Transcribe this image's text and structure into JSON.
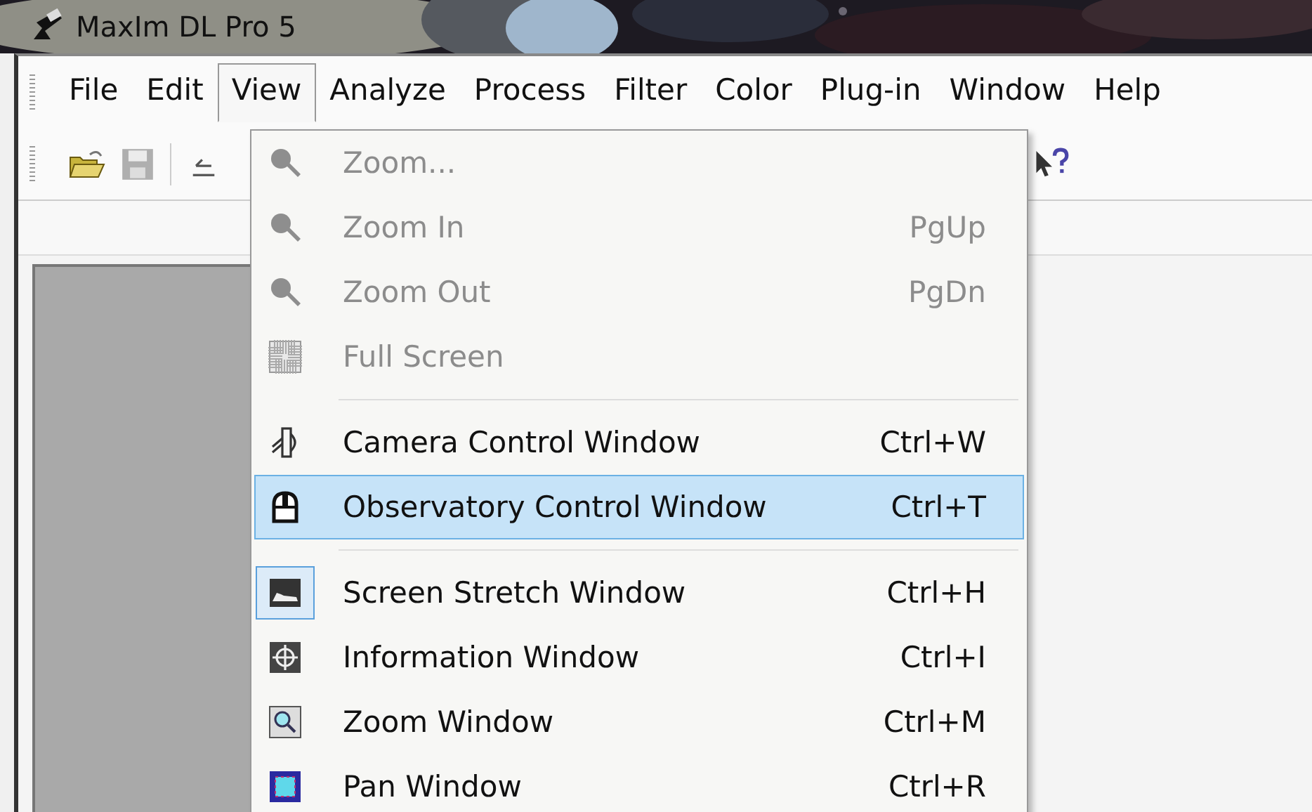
{
  "window": {
    "title": "MaxIm DL Pro 5"
  },
  "menubar": [
    {
      "label": "File",
      "selected": false
    },
    {
      "label": "Edit",
      "selected": false
    },
    {
      "label": "View",
      "selected": true
    },
    {
      "label": "Analyze",
      "selected": false
    },
    {
      "label": "Process",
      "selected": false
    },
    {
      "label": "Filter",
      "selected": false
    },
    {
      "label": "Color",
      "selected": false
    },
    {
      "label": "Plug-in",
      "selected": false
    },
    {
      "label": "Window",
      "selected": false
    },
    {
      "label": "Help",
      "selected": false
    }
  ],
  "toolbar": [
    {
      "kind": "open",
      "disabled": false
    },
    {
      "kind": "save",
      "disabled": true
    },
    {
      "kind": "undo",
      "disabled": false
    },
    {
      "kind": "help",
      "disabled": false
    }
  ],
  "view_menu": [
    {
      "kind": "item",
      "label": "Zoom...",
      "disabled": true,
      "selected": false,
      "checked": false
    },
    {
      "kind": "item",
      "label": "Zoom In",
      "shortcut": "PgUp",
      "disabled": true,
      "selected": false,
      "checked": false
    },
    {
      "kind": "item",
      "label": "Zoom Out",
      "shortcut": "PgDn",
      "disabled": true,
      "selected": false,
      "checked": false
    },
    {
      "kind": "item",
      "label": "Full Screen",
      "disabled": true,
      "selected": false,
      "checked": false
    },
    {
      "kind": "separator"
    },
    {
      "kind": "item",
      "label": "Camera Control Window",
      "shortcut": "Ctrl+W",
      "disabled": false,
      "selected": false,
      "checked": false
    },
    {
      "kind": "item",
      "label": "Observatory Control Window",
      "shortcut": "Ctrl+T",
      "disabled": false,
      "selected": true,
      "checked": false
    },
    {
      "kind": "separator"
    },
    {
      "kind": "item",
      "label": "Screen Stretch Window",
      "shortcut": "Ctrl+H",
      "disabled": false,
      "selected": false,
      "checked": true
    },
    {
      "kind": "item",
      "label": "Information Window",
      "shortcut": "Ctrl+I",
      "disabled": false,
      "selected": false,
      "checked": false
    },
    {
      "kind": "item",
      "label": "Zoom Window",
      "shortcut": "Ctrl+M",
      "disabled": false,
      "selected": false,
      "checked": false
    },
    {
      "kind": "item",
      "label": "Pan Window",
      "shortcut": "Ctrl+R",
      "disabled": false,
      "selected": false,
      "checked": false
    }
  ]
}
